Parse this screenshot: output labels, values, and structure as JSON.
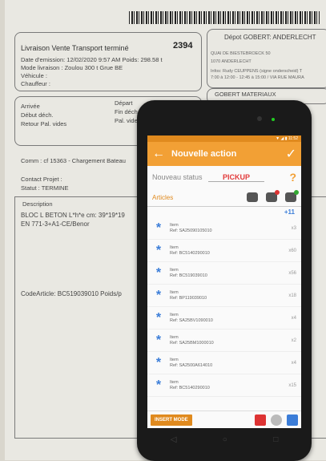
{
  "document": {
    "title": "Livraison Vente Transport terminé",
    "number": "2394",
    "line1": "Date d'emission:  12/02/2020 9:57 AM  Poids:  298.58 t",
    "line2": "Mode livraison :  Zoulou 300 t Grue BE",
    "line3": "Véhicule :",
    "line4": "Chauffeur :",
    "depot_title": "Dépot GOBERT: ANDERLECHT",
    "depot_line1": "QUAI DE BIESTEBROECK 50",
    "depot_line2": "1070     ANDERLECHT",
    "depot_line3": "Infos: Rudy CEUPPENS (signe onderscheid) T",
    "depot_line4": "7:00 à 12:00 - 12:45 à 15:00 / VIA RUE MAURA",
    "gobert": "GOBERT MATERIAUX",
    "arrivee": "Arrivée",
    "depart": "Départ",
    "debut": "Début déch.",
    "fin": "Fin déchar.",
    "retour": "Retour Pal. vides",
    "pal": "Pal. vides",
    "comm": "Comm : cf 15363 - Chargement Bateau",
    "contact": "Contact Projet :",
    "statut": "Statut : TERMINE",
    "description": "Description",
    "bloc": "BLOC L BETON L*h*e cm: 39*19*19",
    "en": "EN 771-3+A1-CE/Benor",
    "codearticle": "CodeArticle: BC519039010   Poids/p"
  },
  "app": {
    "status_right": "▼ ◢ ▮ 11:52",
    "title": "Nouvelle action",
    "status_label": "Nouveau status",
    "status_value": "PICKUP",
    "question": "?",
    "articles": "Articles",
    "count": "+11",
    "items": [
      {
        "name": "Item",
        "ref": "Ref: SA25090105010",
        "qty": "x3"
      },
      {
        "name": "Item",
        "ref": "Ref: BC5140290010",
        "qty": "x60"
      },
      {
        "name": "Item",
        "ref": "Ref: BC519039010",
        "qty": "x56"
      },
      {
        "name": "Item",
        "ref": "Ref: BP119039010",
        "qty": "x18"
      },
      {
        "name": "Item",
        "ref": "Ref: SA25BV1090010",
        "qty": "x4"
      },
      {
        "name": "Item",
        "ref": "Ref: SA25BM1000010",
        "qty": "x2"
      },
      {
        "name": "Item",
        "ref": "Ref: SA2500A614010",
        "qty": "x4"
      },
      {
        "name": "Item",
        "ref": "Ref: BC5140290010",
        "qty": "x15"
      }
    ],
    "insert_mode": "INSERT MODE"
  },
  "colors": {
    "accent": "#f2a035",
    "accent_dark": "#e08a1e",
    "status_red": "#e23a3a",
    "item_blue": "#3b7dd8"
  }
}
